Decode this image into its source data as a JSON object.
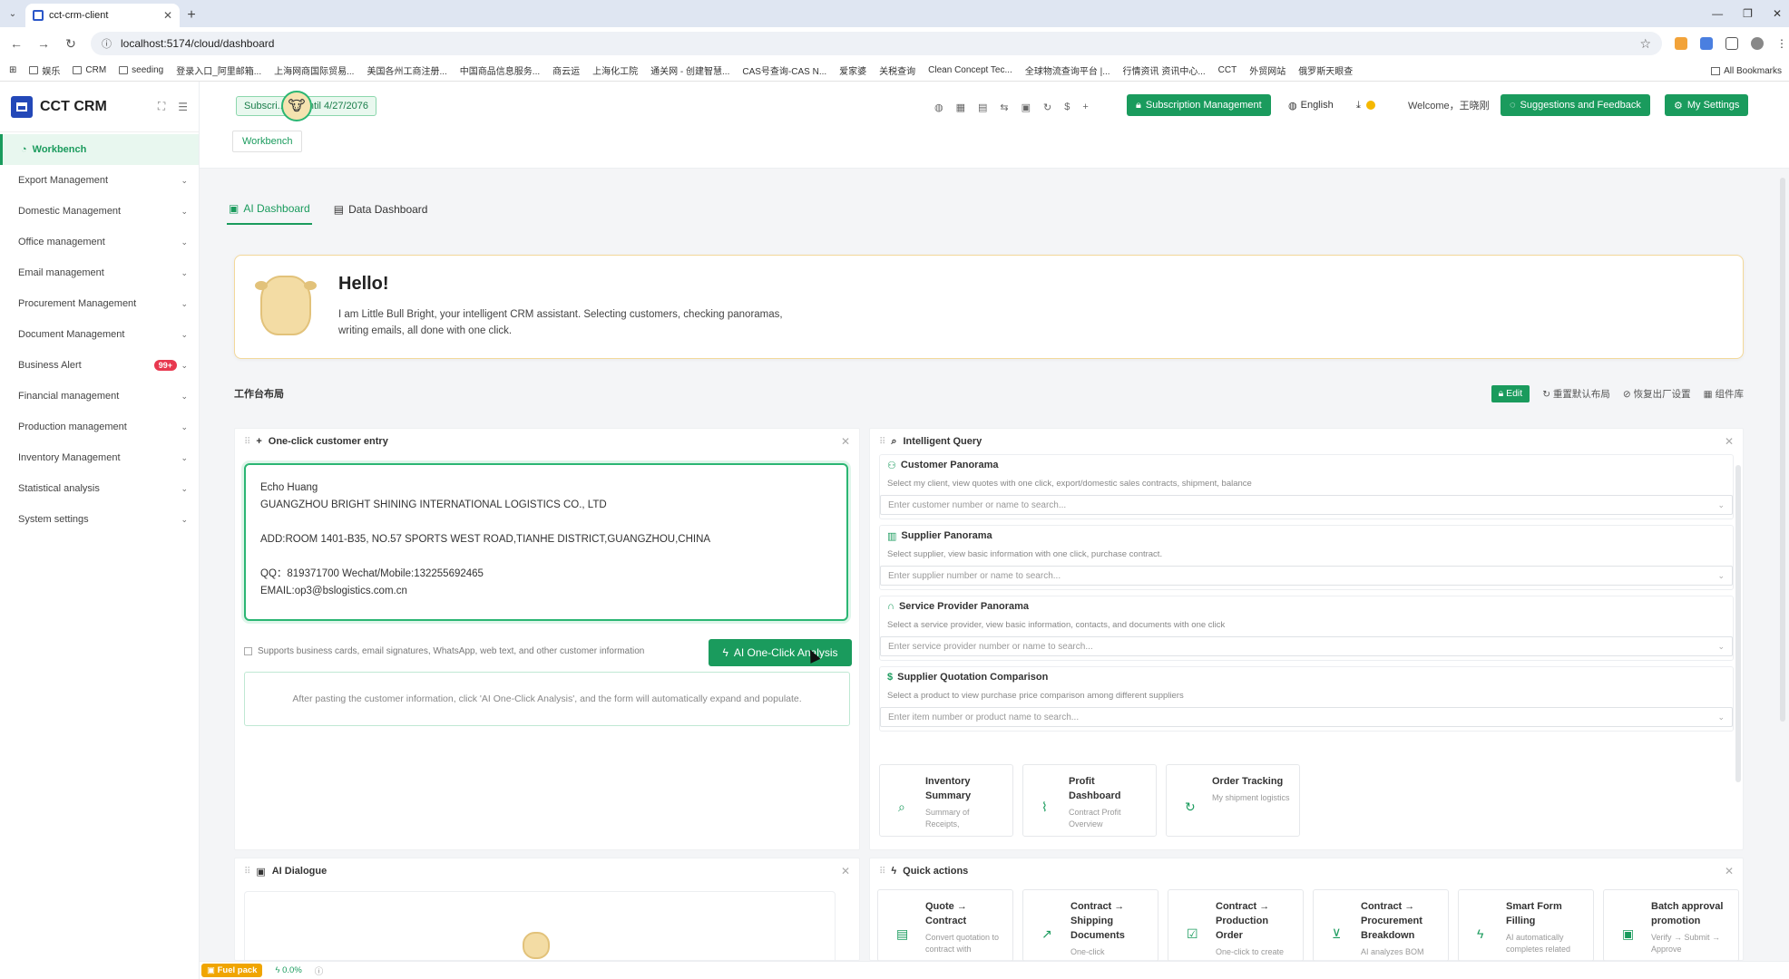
{
  "browser": {
    "tab_title": "cct-crm-client",
    "url": "localhost:5174/cloud/dashboard",
    "bookmarks": [
      "娱乐",
      "CRM",
      "seeding",
      "登录入口_阿里邮箱...",
      "上海网商国际贸易...",
      "美国各州工商注册...",
      "中国商品信息服务...",
      "商云运",
      "上海化工院",
      "通关网 - 创建智慧...",
      "CAS号查询-CAS N...",
      "爱家婆",
      "关税查询",
      "Clean Concept Tec...",
      "全球物流查询平台 |...",
      "行情资讯 资讯中心...",
      "CCT",
      "外贸网站",
      "俄罗斯天眼查"
    ],
    "all_bookmarks": "All Bookmarks"
  },
  "sidebar": {
    "app_name": "CCT CRM",
    "items": [
      {
        "label": "Workbench"
      },
      {
        "label": "Export Management"
      },
      {
        "label": "Domestic Management"
      },
      {
        "label": "Office management"
      },
      {
        "label": "Email management"
      },
      {
        "label": "Procurement Management"
      },
      {
        "label": "Document Management"
      },
      {
        "label": "Business Alert",
        "badge": "99+"
      },
      {
        "label": "Financial management"
      },
      {
        "label": "Production management"
      },
      {
        "label": "Inventory Management"
      },
      {
        "label": "Statistical analysis"
      },
      {
        "label": "System settings"
      }
    ]
  },
  "header": {
    "subscription_badge": "Subscri... lid Until 4/27/2076",
    "workbench_tag": "Workbench",
    "subscription_btn": "Subscription Management",
    "language": "English",
    "welcome": "Welcome，王晓刚",
    "feedback_btn": "Suggestions and Feedback",
    "settings_btn": "My Settings"
  },
  "dashboard_tabs": [
    "AI Dashboard",
    "Data Dashboard"
  ],
  "hello": {
    "title": "Hello!",
    "text": "I am Little Bull Bright, your intelligent CRM assistant. Selecting customers, checking panoramas, writing emails, all done with one click."
  },
  "workbench": {
    "title": "工作台布局",
    "edit": "Edit",
    "reset": "重置默认布局",
    "restore": "恢复出厂设置",
    "library": "组件库"
  },
  "entry_card": {
    "title": "One-click customer entry",
    "lines": [
      "Echo Huang",
      "GUANGZHOU BRIGHT SHINING INTERNATIONAL LOGISTICS CO., LTD",
      "",
      "ADD:ROOM 1401-B35, NO.57 SPORTS WEST ROAD,TIANHE DISTRICT,GUANGZHOU,CHINA",
      "",
      "QQ：819371700      Wechat/Mobile:132255692465",
      "EMAIL:op3@bslogistics.com.cn"
    ],
    "support_text": "Supports business cards, email signatures, WhatsApp, web text, and other customer information",
    "ai_button": "AI One-Click Analysis",
    "hint": "After pasting the customer information, click 'AI One-Click Analysis', and the form will automatically expand and populate."
  },
  "query_card": {
    "title": "Intelligent Query",
    "sections": [
      {
        "title": "Customer Panorama",
        "desc": "Select my client, view quotes with one click, export/domestic sales contracts, shipment, balance",
        "placeholder": "Enter customer number or name to search..."
      },
      {
        "title": "Supplier Panorama",
        "desc": "Select supplier, view basic information with one click, purchase contract.",
        "placeholder": "Enter supplier number or name to search..."
      },
      {
        "title": "Service Provider Panorama",
        "desc": "Select a service provider, view basic information, contacts, and documents with one click",
        "placeholder": "Enter service provider number or name to search..."
      },
      {
        "title": "Supplier Quotation Comparison",
        "desc": "Select a product to view purchase price comparison among different suppliers",
        "placeholder": "Enter item number or product name to search..."
      }
    ],
    "tiles": [
      {
        "title": "Inventory Summary",
        "desc": "Summary of Receipts,"
      },
      {
        "title": "Profit Dashboard",
        "desc": "Contract Profit Overview"
      },
      {
        "title": "Order Tracking",
        "desc": "My shipment logistics"
      }
    ]
  },
  "dialogue_card": {
    "title": "AI Dialogue"
  },
  "quick_card": {
    "title": "Quick actions",
    "tiles": [
      {
        "title": "Quote → Contract",
        "desc": "Convert quotation to contract with"
      },
      {
        "title": "Contract → Shipping Documents",
        "desc": "One-click"
      },
      {
        "title": "Contract → Production Order",
        "desc": "One-click to create"
      },
      {
        "title": "Contract → Procurement Breakdown",
        "desc": "AI analyzes BOM"
      },
      {
        "title": "Smart Form Filling",
        "desc": "AI automatically completes related"
      },
      {
        "title": "Batch approval promotion",
        "desc": "Verify → Submit → Approve"
      }
    ]
  },
  "status": {
    "fuel": "Fuel pack",
    "percent": "0.0%"
  }
}
